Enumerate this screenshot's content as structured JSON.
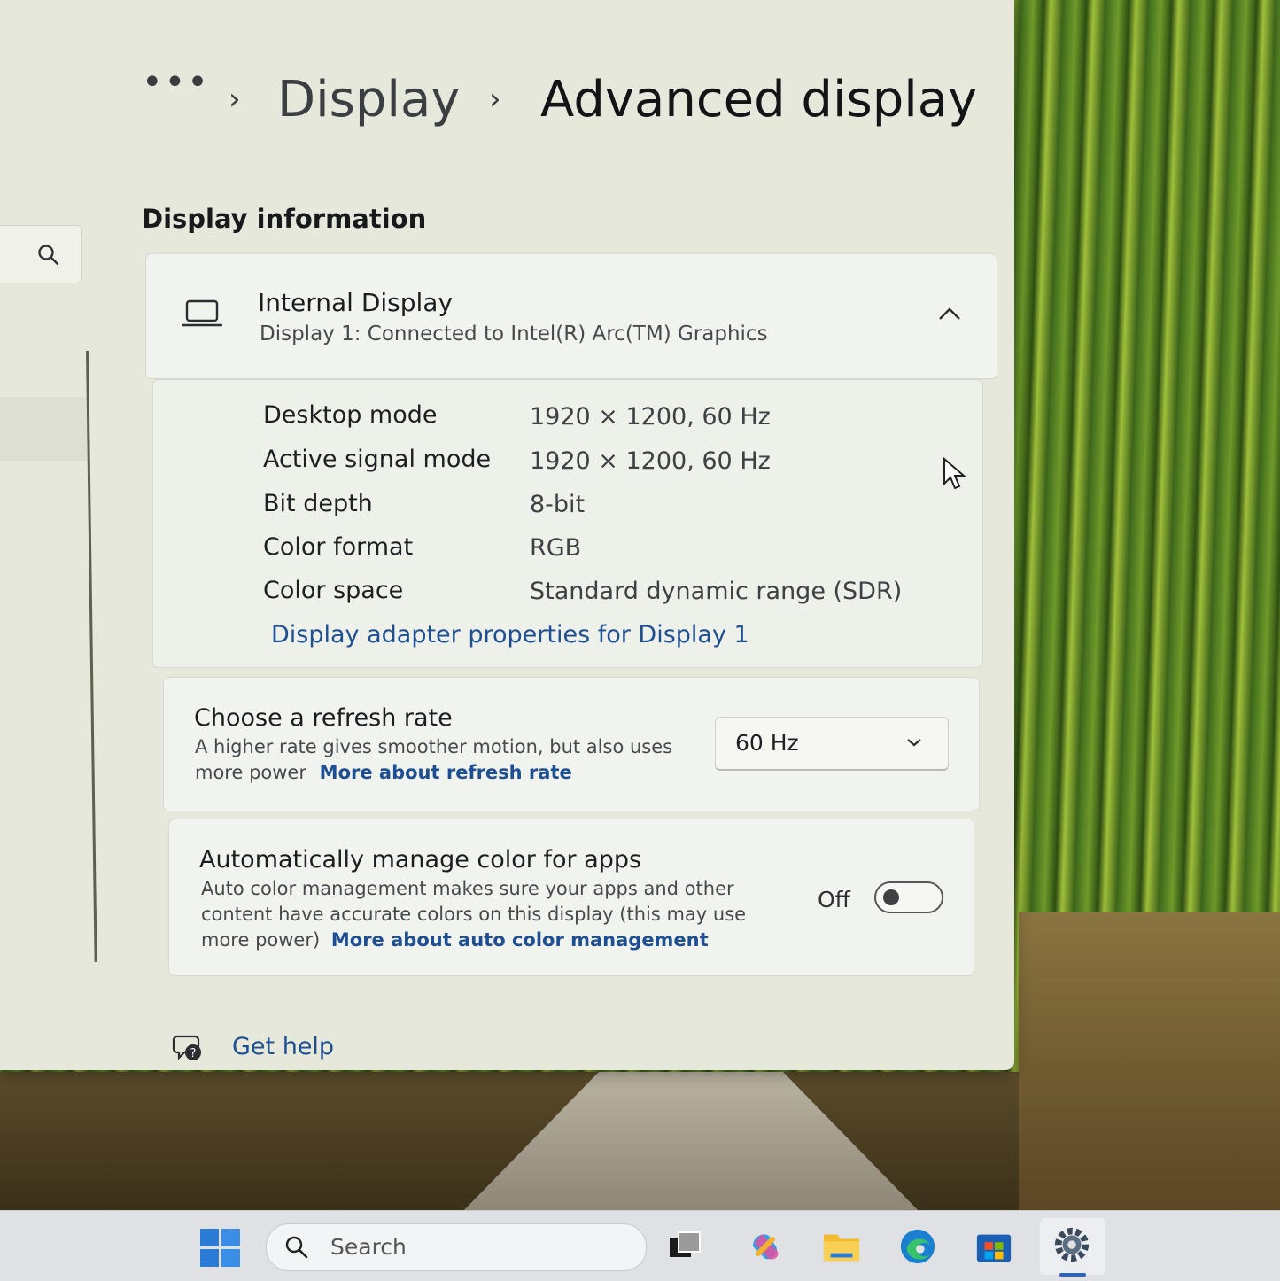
{
  "breadcrumb": {
    "more": "•••",
    "parent": "Display",
    "current": "Advanced display"
  },
  "section_title": "Display information",
  "display_card": {
    "title": "Internal Display",
    "subtitle": "Display 1: Connected to Intel(R) Arc(TM) Graphics",
    "rows": [
      {
        "label": "Desktop mode",
        "value": "1920 × 1200, 60 Hz"
      },
      {
        "label": "Active signal mode",
        "value": "1920 × 1200, 60 Hz"
      },
      {
        "label": "Bit depth",
        "value": "8-bit"
      },
      {
        "label": "Color format",
        "value": "RGB"
      },
      {
        "label": "Color space",
        "value": "Standard dynamic range (SDR)"
      }
    ],
    "adapter_link": "Display adapter properties for Display 1"
  },
  "refresh_rate": {
    "title": "Choose a refresh rate",
    "description": "A higher rate gives smoother motion, but also uses more power",
    "link": "More about refresh rate",
    "selected": "60 Hz"
  },
  "auto_color": {
    "title": "Automatically manage color for apps",
    "description": "Auto color management makes sure your apps and other content have accurate colors on this display (this may use more power)",
    "link": "More about auto color management",
    "state_label": "Off",
    "enabled": false
  },
  "get_help": "Get help",
  "taskbar": {
    "search_placeholder": "Search"
  },
  "colors": {
    "accent": "#2a64c8",
    "link": "#1e4f93",
    "window_bg": "#e6e8dc"
  }
}
